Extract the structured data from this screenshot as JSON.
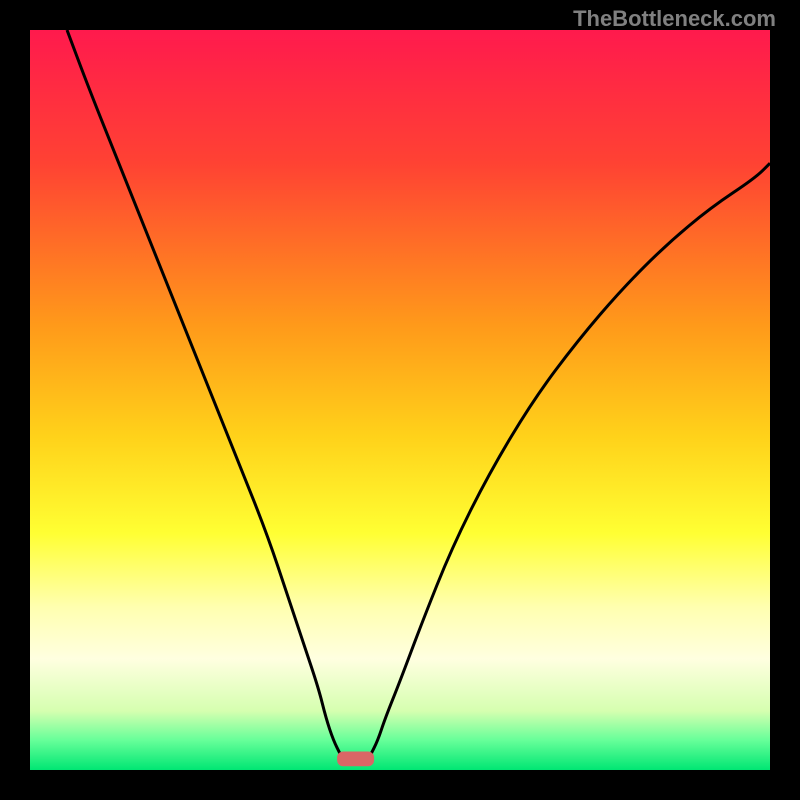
{
  "watermark": "TheBottleneck.com",
  "chart_data": {
    "type": "line",
    "title": "",
    "xlabel": "",
    "ylabel": "",
    "xlim": [
      0,
      100
    ],
    "ylim": [
      0,
      100
    ],
    "gradient_stops": [
      {
        "offset": 0,
        "color": "#ff1a4d"
      },
      {
        "offset": 18,
        "color": "#ff4233"
      },
      {
        "offset": 40,
        "color": "#ff9a1a"
      },
      {
        "offset": 55,
        "color": "#ffd21a"
      },
      {
        "offset": 68,
        "color": "#ffff33"
      },
      {
        "offset": 78,
        "color": "#ffffb0"
      },
      {
        "offset": 85,
        "color": "#ffffe0"
      },
      {
        "offset": 92,
        "color": "#d6ffb0"
      },
      {
        "offset": 96,
        "color": "#66ff99"
      },
      {
        "offset": 100,
        "color": "#00e673"
      }
    ],
    "series": [
      {
        "name": "left-curve",
        "x": [
          5,
          8,
          12,
          16,
          20,
          24,
          28,
          32,
          35,
          37,
          39,
          40,
          41,
          42
        ],
        "y": [
          100,
          92,
          82,
          72,
          62,
          52,
          42,
          32,
          23,
          17,
          11,
          7,
          4,
          2
        ]
      },
      {
        "name": "right-curve",
        "x": [
          46,
          47,
          48,
          50,
          53,
          57,
          62,
          68,
          74,
          80,
          86,
          92,
          98,
          100
        ],
        "y": [
          2,
          4,
          7,
          12,
          20,
          30,
          40,
          50,
          58,
          65,
          71,
          76,
          80,
          82
        ]
      }
    ],
    "marker": {
      "x": 44,
      "y": 1.5,
      "width": 5,
      "height": 2,
      "color": "#d96666"
    }
  }
}
